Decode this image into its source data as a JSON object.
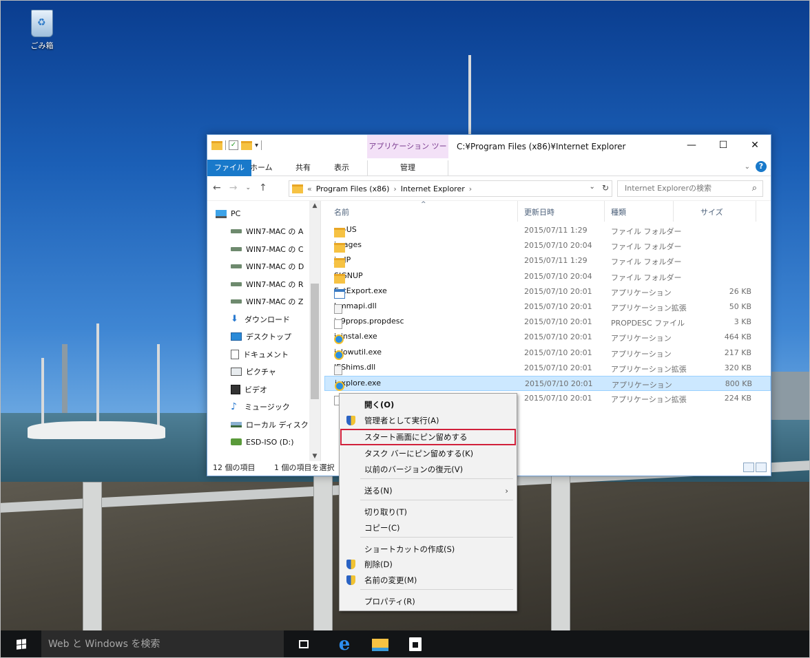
{
  "desktop": {
    "recycle_bin_label": "ごみ箱"
  },
  "explorer": {
    "title_path": "C:¥Program Files (x86)¥Internet Explorer",
    "contextual_tab_group": "アプリケーション ツール",
    "ribbon_tabs": {
      "file": "ファイル",
      "home": "ホーム",
      "share": "共有",
      "view": "表示",
      "manage": "管理"
    },
    "address": {
      "overflow": "«",
      "crumbs": [
        "Program Files (x86)",
        "Internet Explorer"
      ]
    },
    "search_placeholder": "Internet Explorerの検索",
    "columns": {
      "name": "名前",
      "date": "更新日時",
      "type": "種類",
      "size": "サイズ"
    },
    "nav_pane": [
      {
        "label": "PC",
        "icon": "pc-icon"
      },
      {
        "label": "WIN7-MAC の A",
        "icon": "network-drive-icon"
      },
      {
        "label": "WIN7-MAC の C",
        "icon": "network-drive-icon"
      },
      {
        "label": "WIN7-MAC の D",
        "icon": "network-drive-icon"
      },
      {
        "label": "WIN7-MAC の R",
        "icon": "network-drive-icon"
      },
      {
        "label": "WIN7-MAC の Z",
        "icon": "network-drive-icon"
      },
      {
        "label": "ダウンロード",
        "icon": "download-icon"
      },
      {
        "label": "デスクトップ",
        "icon": "desktop-icon"
      },
      {
        "label": "ドキュメント",
        "icon": "document-icon"
      },
      {
        "label": "ピクチャ",
        "icon": "pictures-icon"
      },
      {
        "label": "ビデオ",
        "icon": "video-icon"
      },
      {
        "label": "ミュージック",
        "icon": "music-icon"
      },
      {
        "label": "ローカル ディスク (C",
        "icon": "local-disk-icon"
      },
      {
        "label": "ESD-ISO (D:)",
        "icon": "disc-drive-icon"
      }
    ],
    "files": [
      {
        "name": "en-US",
        "date": "2015/07/11 1:29",
        "type": "ファイル フォルダー",
        "size": "",
        "icon": "folder-icon"
      },
      {
        "name": "images",
        "date": "2015/07/10 20:04",
        "type": "ファイル フォルダー",
        "size": "",
        "icon": "folder-icon"
      },
      {
        "name": "ja-JP",
        "date": "2015/07/11 1:29",
        "type": "ファイル フォルダー",
        "size": "",
        "icon": "folder-icon"
      },
      {
        "name": "SIGNUP",
        "date": "2015/07/10 20:04",
        "type": "ファイル フォルダー",
        "size": "",
        "icon": "folder-icon"
      },
      {
        "name": "ExtExport.exe",
        "date": "2015/07/10 20:01",
        "type": "アプリケーション",
        "size": "26 KB",
        "icon": "app-icon"
      },
      {
        "name": "hmmapi.dll",
        "date": "2015/07/10 20:01",
        "type": "アプリケーション拡張",
        "size": "50 KB",
        "icon": "dll-icon"
      },
      {
        "name": "ie9props.propdesc",
        "date": "2015/07/10 20:01",
        "type": "PROPDESC ファイル",
        "size": "3 KB",
        "icon": "file-icon"
      },
      {
        "name": "ieinstal.exe",
        "date": "2015/07/10 20:01",
        "type": "アプリケーション",
        "size": "464 KB",
        "icon": "ie-icon"
      },
      {
        "name": "ielowutil.exe",
        "date": "2015/07/10 20:01",
        "type": "アプリケーション",
        "size": "217 KB",
        "icon": "ie-icon"
      },
      {
        "name": "IEShims.dll",
        "date": "2015/07/10 20:01",
        "type": "アプリケーション拡張",
        "size": "320 KB",
        "icon": "dll-icon"
      },
      {
        "name": "iexplore.exe",
        "date": "2015/07/10 20:01",
        "type": "アプリケーション",
        "size": "800 KB",
        "icon": "ie-icon",
        "selected": true
      },
      {
        "name": "",
        "date": "2015/07/10 20:01",
        "type": "アプリケーション拡張",
        "size": "224 KB",
        "icon": "file-icon"
      }
    ],
    "status": {
      "item_count": "12 個の項目",
      "selection": "1 個の項目を選択"
    }
  },
  "context_menu": {
    "items": [
      {
        "label": "開く(O)",
        "bold": true
      },
      {
        "label": "管理者として実行(A)",
        "shield": true
      },
      {
        "label": "スタート画面にピン留めする",
        "highlighted": true
      },
      {
        "label": "タスク バーにピン留めする(K)"
      },
      {
        "label": "以前のバージョンの復元(V)"
      },
      {
        "label": "送る(N)",
        "submenu": true
      },
      {
        "label": "切り取り(T)"
      },
      {
        "label": "コピー(C)"
      },
      {
        "label": "ショートカットの作成(S)"
      },
      {
        "label": "削除(D)",
        "shield": true
      },
      {
        "label": "名前の変更(M)",
        "shield": true
      },
      {
        "label": "プロパティ(R)"
      }
    ]
  },
  "taskbar": {
    "search_placeholder": "Web と Windows を検索"
  }
}
